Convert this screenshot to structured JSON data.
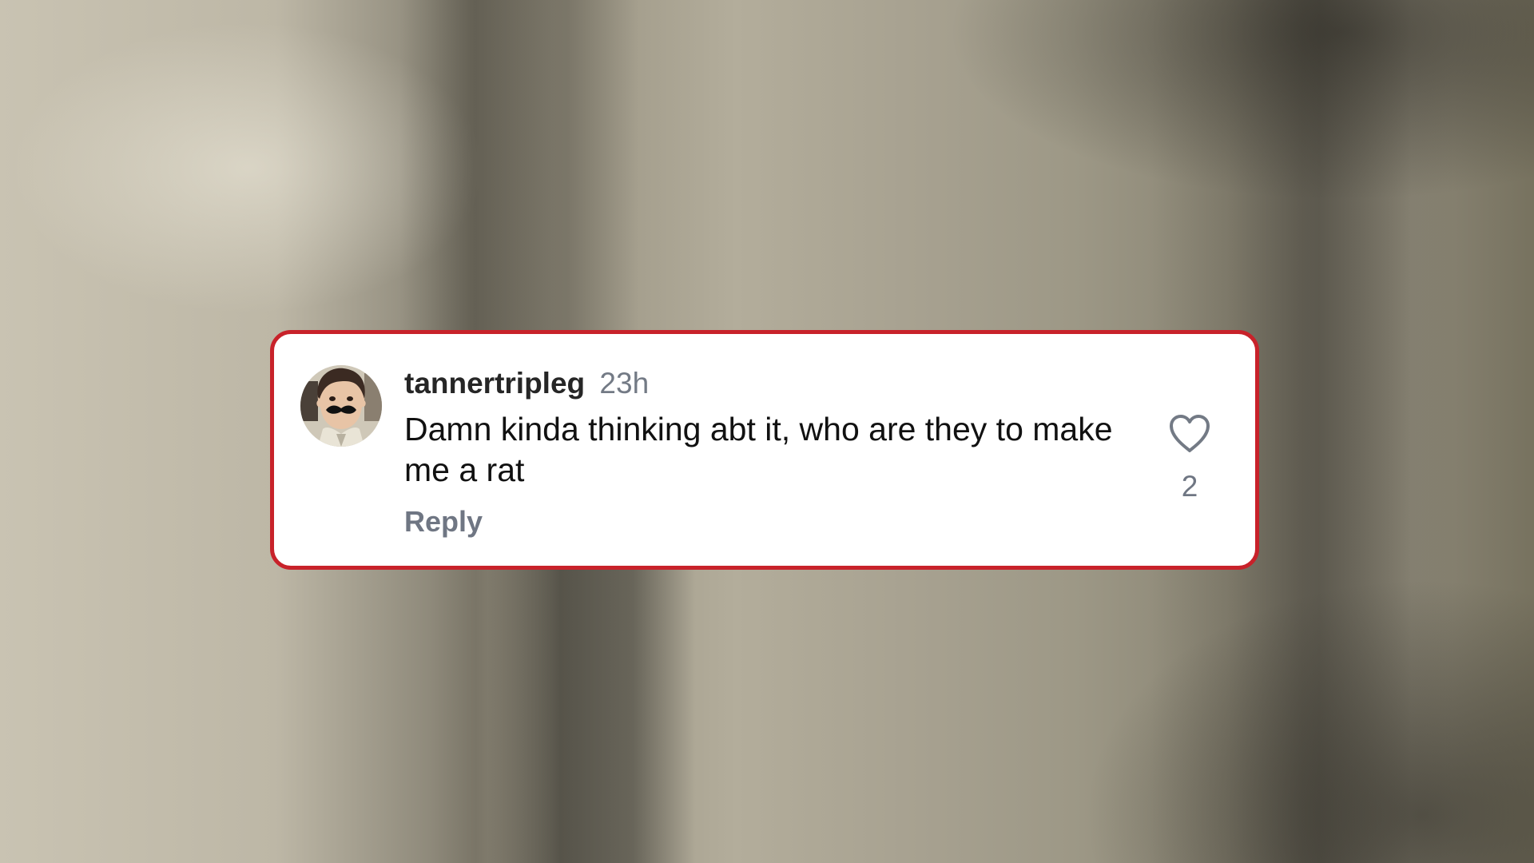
{
  "background": {
    "colors": {
      "light": "#c9c3b2",
      "mid": "#a7a190",
      "dark": "#3a382f"
    }
  },
  "comment": {
    "username": "tannertripleg",
    "timestamp": "23h",
    "text": "Damn kinda thinking abt it, who are they to make me a rat",
    "reply_label": "Reply",
    "like_icon": "heart-outline-icon",
    "like_count": "2",
    "avatar_icon": "user-avatar-photo",
    "colors": {
      "border": "#c8222a",
      "username": "#262626",
      "secondary_text": "#737a85",
      "body_text": "#111111",
      "card_background": "#ffffff"
    }
  }
}
